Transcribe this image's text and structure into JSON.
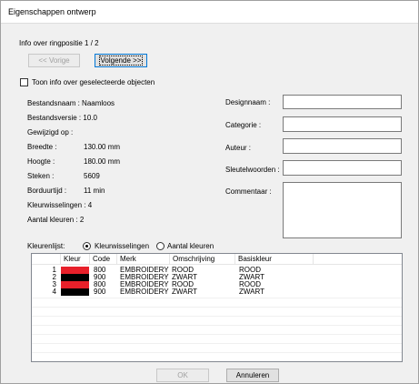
{
  "dialog": {
    "title": "Eigenschappen ontwerp",
    "info_label": "Info over ringpositie 1 / 2",
    "prev_button": "<< Vorige",
    "next_button": "Volgende >>",
    "show_selected_label": "Toon info over geselecteerde objecten"
  },
  "info": {
    "bestandsnaam": "Bestandsnaam : Naamloos",
    "bestandsversie": "Bestandsversie : 10.0",
    "gewijzigd": "Gewijzigd op :",
    "breedte_label": "Breedte :",
    "breedte_value": "130.00 mm",
    "hoogte_label": "Hoogte :",
    "hoogte_value": "180.00 mm",
    "steken_label": "Steken :",
    "steken_value": "5609",
    "borduurtijd_label": "Borduurtijd :",
    "borduurtijd_value": "11 min",
    "kleurwisselingen": "Kleurwisselingen : 4",
    "aantal_kleuren": "Aantal kleuren :  2"
  },
  "meta": {
    "designnaam_label": "Designnaam :",
    "designnaam_value": "",
    "categorie_label": "Categorie :",
    "categorie_value": "",
    "auteur_label": "Auteur :",
    "auteur_value": "",
    "sleutelwoorden_label": "Sleutelwoorden :",
    "sleutelwoorden_value": "",
    "commentaar_label": "Commentaar :",
    "commentaar_value": ""
  },
  "colorlist": {
    "label": "Kleurenlijst:",
    "option_changes": "Kleurwisselingen",
    "option_colors": "Aantal kleuren",
    "selected": "Kleurwisselingen",
    "columns": [
      "Kleur",
      "Code",
      "Merk",
      "Omschrijving",
      "Basiskleur"
    ],
    "rows": [
      {
        "num": "1",
        "color": "#e8202a",
        "code": "800",
        "merk": "EMBROIDERY",
        "omschrijving": "ROOD",
        "basiskleur": "ROOD"
      },
      {
        "num": "2",
        "color": "#000000",
        "code": "900",
        "merk": "EMBROIDERY",
        "omschrijving": "ZWART",
        "basiskleur": "ZWART"
      },
      {
        "num": "3",
        "color": "#e8202a",
        "code": "800",
        "merk": "EMBROIDERY",
        "omschrijving": "ROOD",
        "basiskleur": "ROOD"
      },
      {
        "num": "4",
        "color": "#000000",
        "code": "900",
        "merk": "EMBROIDERY",
        "omschrijving": "ZWART",
        "basiskleur": "ZWART"
      }
    ]
  },
  "footer": {
    "ok_button": "OK",
    "cancel_button": "Annuleren"
  }
}
